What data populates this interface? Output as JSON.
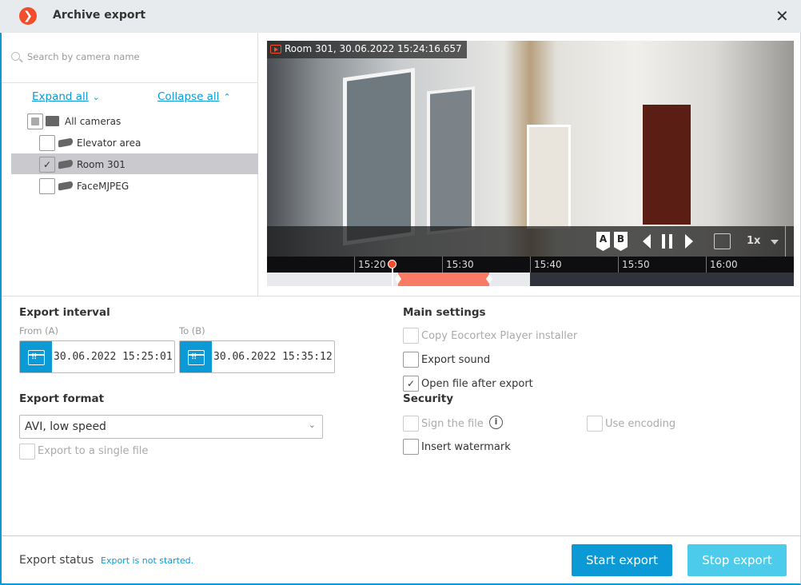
{
  "window": {
    "title": "Archive export",
    "close_icon": "close-icon"
  },
  "colors": {
    "accent": "#0b9ad6",
    "brand": "#f24e2e",
    "selection": "#f97a65",
    "stop_disabled": "#4ccbea"
  },
  "camera_tree": {
    "search_placeholder": "Search by camera name",
    "expand_all": "Expand all",
    "collapse_all": "Collapse all",
    "root": {
      "label": "All cameras",
      "state": "partial"
    },
    "items": [
      {
        "label": "Elevator area",
        "checked": false
      },
      {
        "label": "Room 301",
        "checked": true,
        "selected": true
      },
      {
        "label": "FaceMJPEG",
        "checked": false
      }
    ]
  },
  "player": {
    "overlay": "Room 301, 30.06.2022 15:24:16.657",
    "mark_a": "A",
    "mark_b": "B",
    "speed": "1x",
    "timeline_ticks": [
      "15:20",
      "15:30",
      "15:40",
      "15:50",
      "16:00"
    ],
    "cursor_time": "15:24:16"
  },
  "export_interval": {
    "heading": "Export interval",
    "from_label": "From (A)",
    "from_value": "30.06.2022  15:25:01",
    "to_label": "To (B)",
    "to_value": "30.06.2022  15:35:12"
  },
  "export_format": {
    "heading": "Export format",
    "selected": "AVI, low speed",
    "single_file": {
      "label": "Export to a single file",
      "checked": false,
      "disabled": true
    }
  },
  "main_settings": {
    "heading": "Main settings",
    "copy_installer": {
      "label": "Copy Eocortex Player installer",
      "checked": false,
      "disabled": true
    },
    "export_sound": {
      "label": "Export sound",
      "checked": false
    },
    "open_after": {
      "label": "Open file after export",
      "checked": true
    }
  },
  "security": {
    "heading": "Security",
    "sign": {
      "label": "Sign the file",
      "checked": false,
      "disabled": true
    },
    "encoding": {
      "label": "Use encoding",
      "checked": false,
      "disabled": true
    },
    "watermark": {
      "label": "Insert watermark",
      "checked": false
    }
  },
  "footer": {
    "status_label": "Export status",
    "status_value": "Export is not started.",
    "start": "Start export",
    "stop": "Stop export"
  }
}
